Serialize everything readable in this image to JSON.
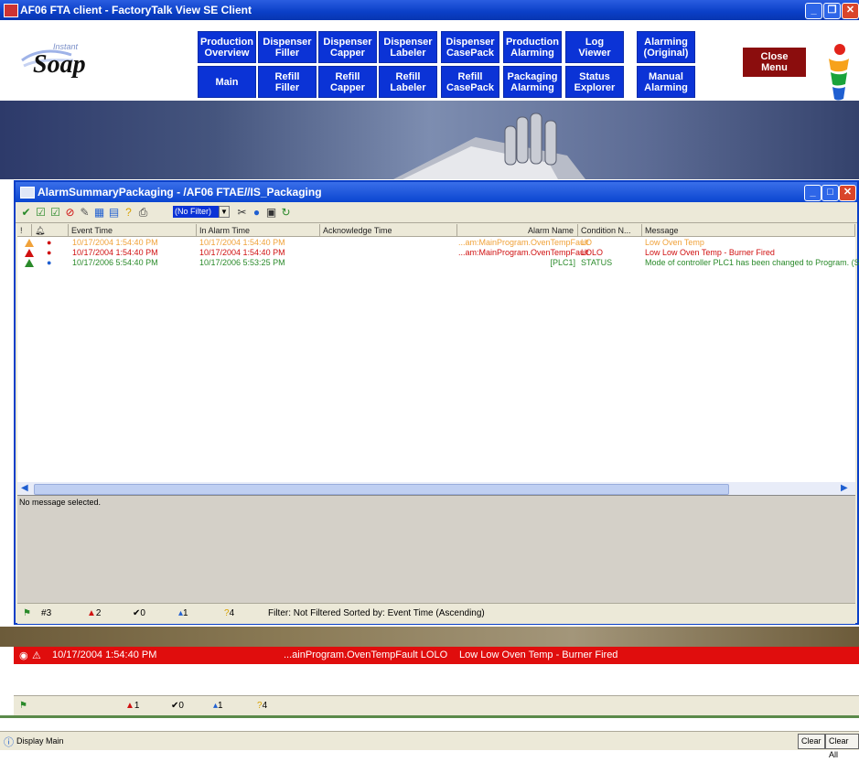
{
  "window": {
    "title": "AF06 FTA client - FactoryTalk View SE Client"
  },
  "logo": {
    "tagline": "Instant",
    "brand": "Soap"
  },
  "nav": {
    "row1": [
      "Production\nOverview",
      "Dispenser\nFiller",
      "Dispenser\nCapper",
      "Dispenser\nLabeler",
      "Dispenser\nCasePack",
      "Production\nAlarming",
      "Log\nViewer",
      "Alarming\n(Original)"
    ],
    "row2": [
      "Main",
      "Refill\nFiller",
      "Refill\nCapper",
      "Refill\nLabeler",
      "Refill\nCasePack",
      "Packaging\nAlarming",
      "Status\nExplorer",
      "Manual\nAlarming"
    ],
    "close_menu": "Close\nMenu"
  },
  "summary": {
    "title": "AlarmSummaryPackaging - /AF06 FTAE//IS_Packaging",
    "filter": "(No Filter)",
    "columns": {
      "bang": "!",
      "event_time": "Event Time",
      "in_alarm_time": "In Alarm Time",
      "ack_time": "Acknowledge Time",
      "alarm_name": "Alarm Name",
      "condition": "Condition N...",
      "message": "Message"
    },
    "rows": [
      {
        "event_time": "10/17/2004 1:54:40 PM",
        "in_alarm_time": "10/17/2004 1:54:40 PM",
        "ack_time": "",
        "alarm_name": "...am:MainProgram.OvenTempFault",
        "condition": "LO",
        "message": "Low Oven Temp",
        "color": "#f0a23a"
      },
      {
        "event_time": "10/17/2004 1:54:40 PM",
        "in_alarm_time": "10/17/2004 1:54:40 PM",
        "ack_time": "",
        "alarm_name": "...am:MainProgram.OvenTempFault",
        "condition": "LOLO",
        "message": "Low Low Oven Temp - Burner Fired",
        "color": "#d01010"
      },
      {
        "event_time": "10/17/2006 5:54:40 PM",
        "in_alarm_time": "10/17/2006 5:53:25 PM",
        "ack_time": "",
        "alarm_name": "[PLC1]",
        "condition": "STATUS",
        "message": "Mode of controller PLC1 has been changed to Program. (S",
        "color": "#2a8a2a"
      }
    ],
    "detail_message": "No message selected.",
    "status": {
      "total": "3",
      "in_alarm": "2",
      "acked": "0",
      "normal": "1",
      "unacked": "4",
      "filter_text": "Filter: Not Filtered   Sorted by: Event Time (Ascending)"
    }
  },
  "banner": {
    "time": "10/17/2004 1:54:40 PM",
    "alarm": "...ainProgram.OvenTempFault LOLO",
    "message": "Low Low Oven Temp - Burner Fired"
  },
  "banner_status": {
    "in_alarm": "1",
    "acked": "0",
    "normal": "1",
    "unacked": "4"
  },
  "command": {
    "text": "Display Main",
    "clear": "Clear",
    "clear_all": "Clear All"
  },
  "colors": {
    "nav_button": "#0b33d6",
    "close_menu": "#8b0d0d",
    "alarm_banner": "#e00d0d"
  }
}
